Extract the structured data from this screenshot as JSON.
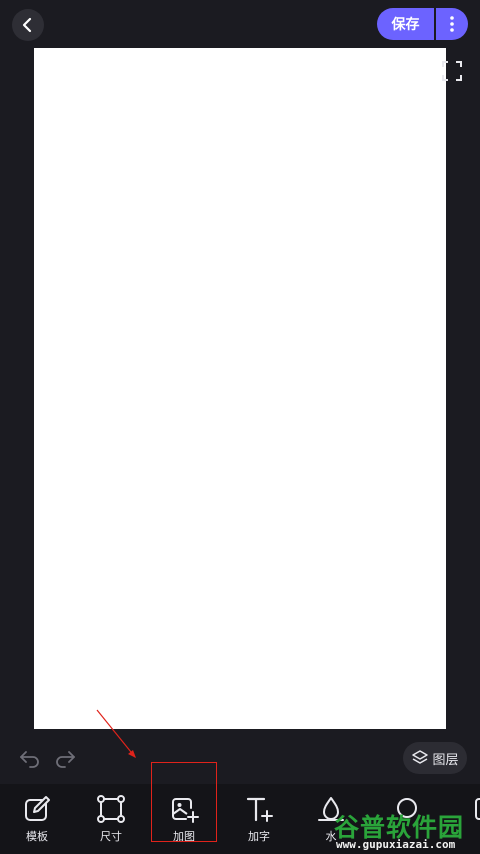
{
  "header": {
    "save_label": "保存"
  },
  "canvas": {
    "background": "#ffffff"
  },
  "history": {
    "undo_icon": "undo-icon",
    "redo_icon": "redo-icon"
  },
  "layers": {
    "label": "图层"
  },
  "toolbar": {
    "items": [
      {
        "label": "模板",
        "icon": "edit-icon"
      },
      {
        "label": "尺寸",
        "icon": "resize-icon"
      },
      {
        "label": "加图",
        "icon": "add-image-icon"
      },
      {
        "label": "加字",
        "icon": "add-text-icon"
      },
      {
        "label": "水",
        "icon": "watermark-icon"
      }
    ]
  },
  "annotation": {
    "color": "#e0231b",
    "target": "加图"
  },
  "watermark": {
    "text": "谷普软件园",
    "url": "www.gupuxiazai.com"
  },
  "colors": {
    "accent": "#6c63ff",
    "background": "#1b1b21",
    "toolbar": "#141418"
  }
}
